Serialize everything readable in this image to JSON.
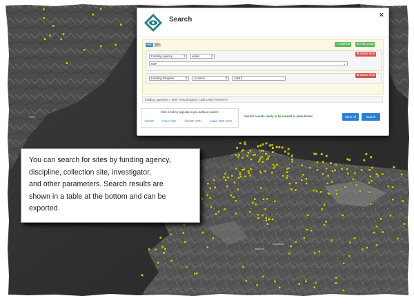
{
  "dialog": {
    "title": "Search",
    "close_label": "×",
    "logo_icon": "diamond-eye-logo",
    "query_builder": {
      "and_label": "AND",
      "or_label": "OR",
      "add_rule_label": "+ Add field",
      "add_group_label": "⊕ Add group",
      "delete_label": "✖ Delete field",
      "rule1": {
        "field": "Funding Agency",
        "operator": "equal",
        "value": "NSF"
      },
      "rule2": {
        "field": "Funding Program",
        "operator": "contains",
        "value": "AON"
      }
    },
    "sql_text": "funding_agencies = 'NSF' AND program_code LIKE('%AON%')",
    "predefined": {
      "title": "Click a link to populate a pre-defined search:",
      "links": [
        "All NSF",
        "Active NSF",
        "All NSF AON",
        "Active NSF AON"
      ]
    },
    "status_text": "Search results ready to be viewed in table below.",
    "clear_label": "Clear All",
    "search_label": "Search"
  },
  "callout": {
    "text": "You can search for sites by funding agency,\ndiscipline, collection site, investigator,\nand other parameters.  Search results are\nshown in a table at the bottom and can be\nexported."
  },
  "map_labels": {
    "label1": "Barrow",
    "label2": "Teller",
    "label3": "Kotzebue"
  },
  "colors": {
    "marker": "#cccc00",
    "map_dark": "#2c2c2c",
    "primary": "#2e7fd3"
  }
}
